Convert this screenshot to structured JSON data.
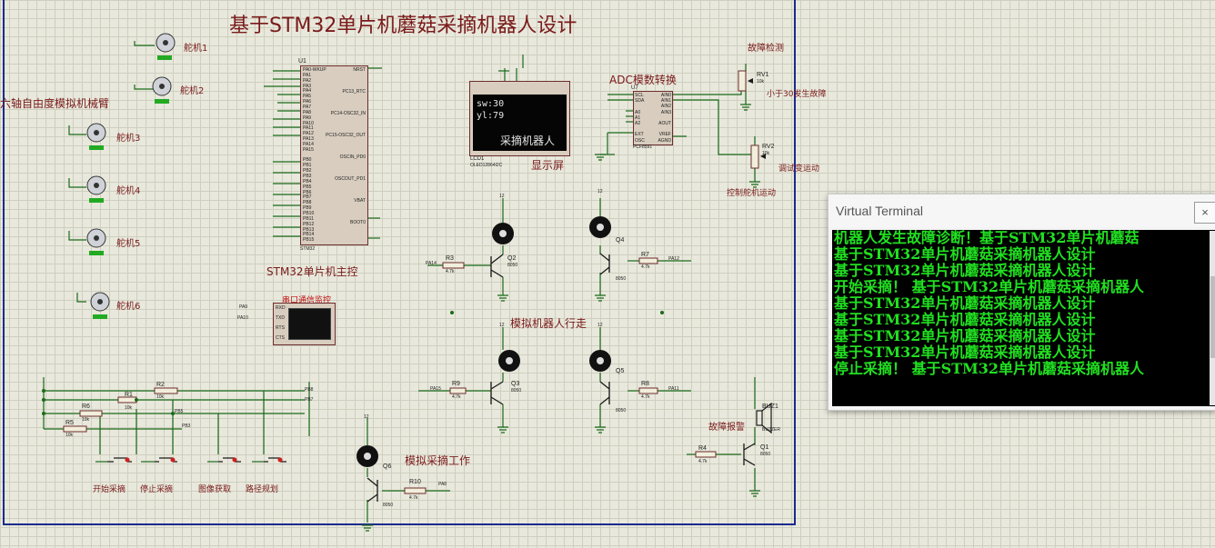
{
  "schematic": {
    "title": "基于STM32单片机蘑菇采摘机器人设计",
    "mcu": {
      "ref": "U1",
      "part": "STM32",
      "label": "STM32单片机主控",
      "left_pins": [
        "PA0-WKUP",
        "PA1",
        "PA2",
        "PA3",
        "PA4",
        "PA5",
        "PA6",
        "PA7",
        "PA8",
        "PA9",
        "PA10",
        "PA11",
        "PA12",
        "PA13",
        "PA14",
        "PA15",
        "",
        "PB0",
        "PB1",
        "PB2",
        "PB3",
        "PB4",
        "PB5",
        "PB6",
        "PB7",
        "PB8",
        "PB9",
        "PB10",
        "PB11",
        "PB12",
        "PB13",
        "PB14",
        "PB15"
      ],
      "right_pins": [
        "NRST",
        "PC13_RTC",
        "PC14-OSC32_IN",
        "PC15-OSC32_OUT",
        "OSCIN_PD0",
        "OSCOUT_PD1",
        "VBAT",
        "BOOT0"
      ]
    },
    "lcd": {
      "screen_line1": "sw:30",
      "screen_line2": "yl:79",
      "screen_line3": "采摘机器人",
      "ref": "LCD1",
      "part": "OLED12864I2C",
      "label": "显示屏"
    },
    "adc": {
      "label": "ADC模数转换",
      "ref": "U7",
      "part": "PCF8591",
      "left_pins": [
        "SCL",
        "SDA",
        "",
        "A0",
        "A1",
        "A2",
        "",
        "EXT",
        "OSC"
      ],
      "right_pins": [
        "AIN0",
        "AIN1",
        "AIN2",
        "AIN3",
        "",
        "AOUT",
        "",
        "VREF",
        "AGND"
      ]
    },
    "pots": [
      {
        "ref": "RV1",
        "value": "10k",
        "label_top": "故障检测",
        "label_side": "小于30发生故障"
      },
      {
        "ref": "RV2",
        "value": "10k",
        "label_top": "",
        "label_side": "调试变运动",
        "label_bottom": "控制舵机运动"
      }
    ],
    "arm": {
      "label": "六轴自由度模拟机械臂",
      "servos": [
        "舵机1",
        "舵机2",
        "舵机3",
        "舵机4",
        "舵机5",
        "舵机6"
      ]
    },
    "serial": {
      "label": "串口通信监控",
      "pins": [
        "RXD",
        "TXD",
        "RTS",
        "CTS"
      ],
      "nets": [
        "PA9",
        "PA10"
      ]
    },
    "motors": {
      "walk_label": "模拟机器人行走",
      "pick_label": "模拟采摘工作",
      "transistors": [
        {
          "ref": "Q2",
          "part": "8050",
          "resistor": "R3",
          "res_value": "4.7k",
          "net": "PA14"
        },
        {
          "ref": "Q4",
          "part": "8050",
          "resistor": "R7",
          "res_value": "4.7k",
          "net": "PA12"
        },
        {
          "ref": "Q3",
          "part": "8050",
          "resistor": "R9",
          "res_value": "4.7k",
          "net": "PA15"
        },
        {
          "ref": "Q5",
          "part": "8050",
          "resistor": "R8",
          "res_value": "4.7k",
          "net": "PA11"
        },
        {
          "ref": "Q6",
          "part": "8050",
          "resistor": "R10",
          "res_value": "4.7k",
          "net": "PA8"
        }
      ],
      "supply": "12"
    },
    "buzzer": {
      "ref": "BUZ1",
      "part": "BUZZER",
      "label": "故障报警",
      "q_ref": "Q1",
      "q_part": "8050",
      "r_ref": "R4",
      "r_value": "4.7k"
    },
    "buttons": {
      "labels": [
        "开始采摘",
        "停止采摘",
        "图像获取",
        "路径规划"
      ],
      "resistors": [
        {
          "ref": "R2",
          "value": "10k",
          "net": "PB8"
        },
        {
          "ref": "R1",
          "value": "10k",
          "net": "PB7"
        },
        {
          "ref": "R6",
          "value": "10k",
          "net": "PB5"
        },
        {
          "ref": "R5",
          "value": "10k",
          "net": "PB3"
        }
      ]
    }
  },
  "terminal": {
    "title": "Virtual Terminal",
    "close_glyph": "×",
    "lines": [
      "机器人发生故障诊断！基于STM32单片机蘑菇",
      "基于STM32单片机蘑菇采摘机器人设计",
      "基于STM32单片机蘑菇采摘机器人设计",
      "开始采摘！ 基于STM32单片机蘑菇采摘机器人",
      "基于STM32单片机蘑菇采摘机器人设计",
      "基于STM32单片机蘑菇采摘机器人设计",
      "基于STM32单片机蘑菇采摘机器人设计",
      "基于STM32单片机蘑菇采摘机器人设计",
      "停止采摘！ 基于STM32单片机蘑菇采摘机器人"
    ]
  },
  "colors": {
    "frame": "#1c2a8c",
    "wire": "#1a6a1a",
    "label": "#7a1a1a",
    "terminal_text": "#21e021",
    "terminal_bg": "#000000"
  }
}
